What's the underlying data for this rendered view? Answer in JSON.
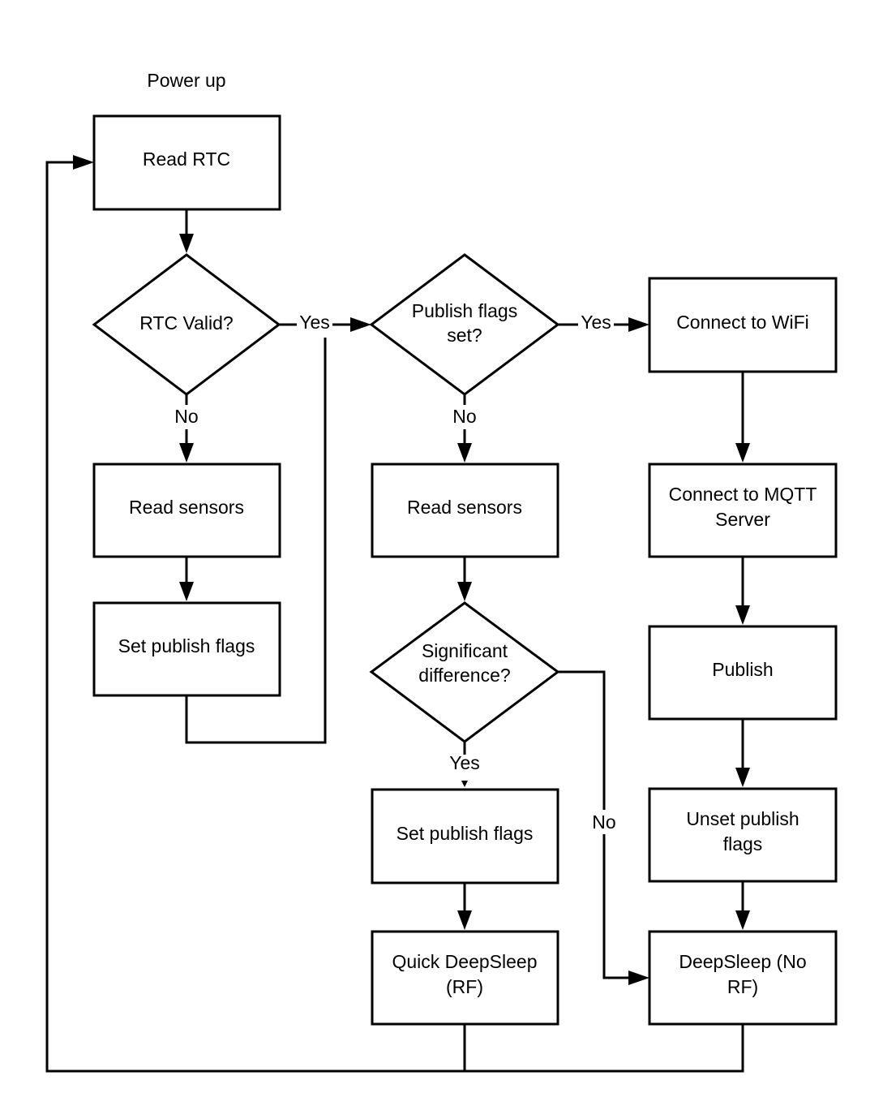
{
  "diagram": {
    "type": "flowchart",
    "start_label": "Power up",
    "nodes": {
      "read_rtc": {
        "shape": "process",
        "lines": [
          "Read RTC"
        ]
      },
      "rtc_valid": {
        "shape": "decision",
        "lines": [
          "RTC Valid?"
        ]
      },
      "read_sensors_1": {
        "shape": "process",
        "lines": [
          "Read sensors"
        ]
      },
      "set_flags_1": {
        "shape": "process",
        "lines": [
          "Set publish flags"
        ]
      },
      "publish_flags_set": {
        "shape": "decision",
        "lines": [
          "Publish flags",
          "set?"
        ]
      },
      "read_sensors_2": {
        "shape": "process",
        "lines": [
          "Read sensors"
        ]
      },
      "significant_diff": {
        "shape": "decision",
        "lines": [
          "Significant",
          "difference?"
        ]
      },
      "set_flags_2": {
        "shape": "process",
        "lines": [
          "Set publish flags"
        ]
      },
      "quick_deepsleep": {
        "shape": "process",
        "lines": [
          "Quick DeepSleep",
          "(RF)"
        ]
      },
      "connect_wifi": {
        "shape": "process",
        "lines": [
          "Connect to WiFi"
        ]
      },
      "connect_mqtt": {
        "shape": "process",
        "lines": [
          "Connect to MQTT",
          "Server"
        ]
      },
      "publish": {
        "shape": "process",
        "lines": [
          "Publish"
        ]
      },
      "unset_flags": {
        "shape": "process",
        "lines": [
          "Unset publish",
          "flags"
        ]
      },
      "deepsleep_norf": {
        "shape": "process",
        "lines": [
          "DeepSleep (No",
          "RF)"
        ]
      }
    },
    "edges": [
      {
        "from": "read_rtc",
        "to": "rtc_valid",
        "label": ""
      },
      {
        "from": "rtc_valid",
        "to": "publish_flags_set",
        "label": "Yes"
      },
      {
        "from": "rtc_valid",
        "to": "read_sensors_1",
        "label": "No"
      },
      {
        "from": "read_sensors_1",
        "to": "set_flags_1",
        "label": ""
      },
      {
        "from": "set_flags_1",
        "to": "publish_flags_set",
        "label": ""
      },
      {
        "from": "publish_flags_set",
        "to": "connect_wifi",
        "label": "Yes"
      },
      {
        "from": "publish_flags_set",
        "to": "read_sensors_2",
        "label": "No"
      },
      {
        "from": "read_sensors_2",
        "to": "significant_diff",
        "label": ""
      },
      {
        "from": "significant_diff",
        "to": "set_flags_2",
        "label": "Yes"
      },
      {
        "from": "significant_diff",
        "to": "deepsleep_norf",
        "label": "No"
      },
      {
        "from": "set_flags_2",
        "to": "quick_deepsleep",
        "label": ""
      },
      {
        "from": "connect_wifi",
        "to": "connect_mqtt",
        "label": ""
      },
      {
        "from": "connect_mqtt",
        "to": "publish",
        "label": ""
      },
      {
        "from": "publish",
        "to": "unset_flags",
        "label": ""
      },
      {
        "from": "unset_flags",
        "to": "deepsleep_norf",
        "label": ""
      },
      {
        "from": "quick_deepsleep",
        "to": "read_rtc",
        "label": ""
      },
      {
        "from": "deepsleep_norf",
        "to": "read_rtc",
        "label": ""
      }
    ],
    "edge_labels": {
      "yes": "Yes",
      "no": "No"
    }
  }
}
